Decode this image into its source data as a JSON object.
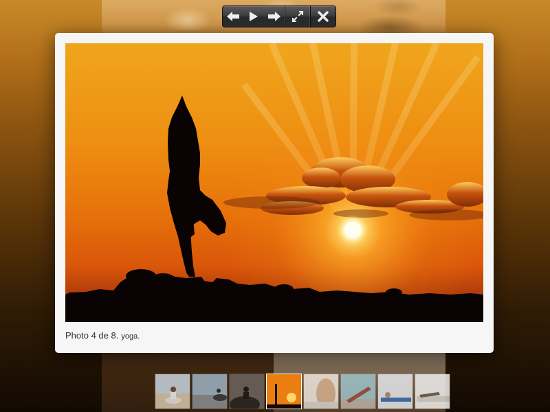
{
  "controls": {
    "previous": {
      "icon": "arrow-left-icon"
    },
    "play": {
      "icon": "play-icon"
    },
    "next": {
      "icon": "arrow-right-icon"
    },
    "fullscreen": {
      "icon": "expand-icon"
    },
    "close": {
      "icon": "close-icon"
    }
  },
  "photo": {
    "counter": "Photo 4 de 8.",
    "title": "yoga.",
    "current_index": 4,
    "total": 8
  },
  "thumbnails": [
    {
      "subject": "woman meditating on beach",
      "active": false
    },
    {
      "subject": "seated yoga pose on shore",
      "active": false
    },
    {
      "subject": "silhouette meditating on rocks",
      "active": false
    },
    {
      "subject": "tree pose at sunset",
      "active": true
    },
    {
      "subject": "stretching legs close-up",
      "active": false
    },
    {
      "subject": "side plank pose",
      "active": false
    },
    {
      "subject": "lying leg stretch",
      "active": false
    },
    {
      "subject": "floor stretch on mat",
      "active": false
    }
  ],
  "colors": {
    "panel": "#f6f6f6",
    "sky": "#f08a12",
    "sun": "#fff3b0",
    "background_top": "#c88a28",
    "background_bottom": "#120a02"
  }
}
